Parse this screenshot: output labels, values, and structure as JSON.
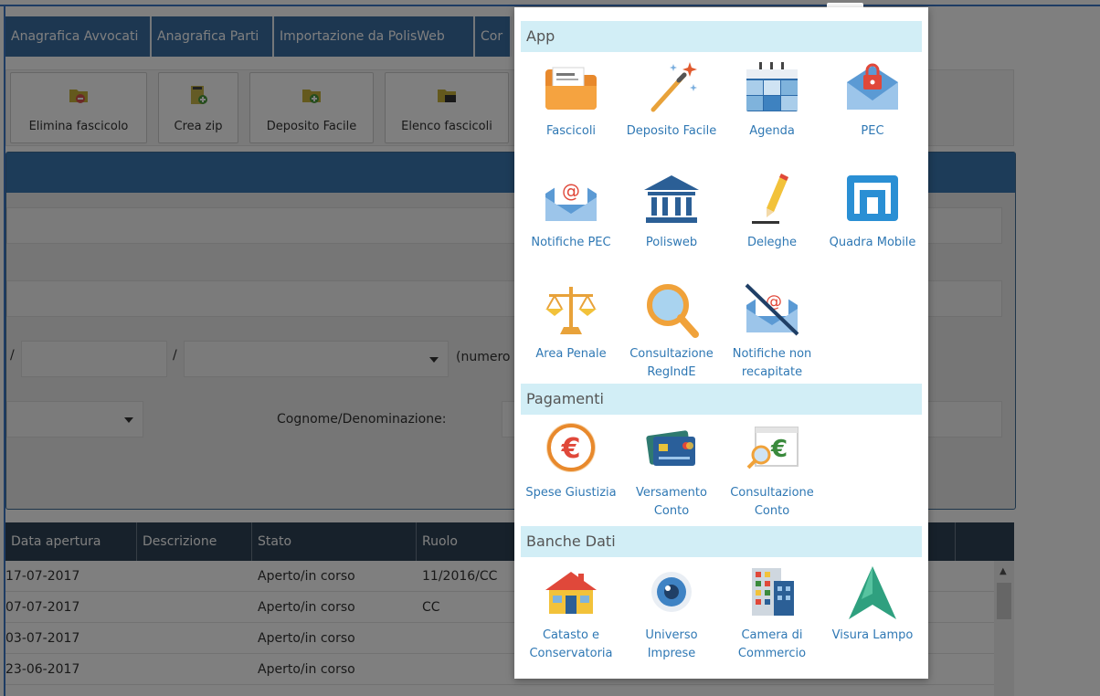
{
  "tabs": [
    "Anagrafica Avvocati",
    "Anagrafica Parti",
    "Importazione da PolisWeb",
    "Cor"
  ],
  "toolbar": {
    "buttons": [
      "Elimina fascicolo",
      "Crea zip",
      "Deposito Facile",
      "Elenco fascicoli"
    ]
  },
  "form": {
    "slash1": "/",
    "slash2": "/",
    "numero_hint": "(numero",
    "cognome_label": "Cognome/Denominazione:"
  },
  "grid": {
    "columns": [
      "Data apertura",
      "Descrizione",
      "Stato",
      "Ruolo"
    ],
    "rows": [
      {
        "data": "17-07-2017",
        "stato": "Aperto/in corso",
        "ruolo": "11/2016/CC"
      },
      {
        "data": "07-07-2017",
        "stato": "Aperto/in corso",
        "ruolo": "CC"
      },
      {
        "data": "03-07-2017",
        "stato": "Aperto/in corso",
        "ruolo": ""
      },
      {
        "data": "23-06-2017",
        "stato": "Aperto/in corso",
        "ruolo": ""
      }
    ]
  },
  "popup": {
    "app_title": "App",
    "pagamenti_title": "Pagamenti",
    "banche_title": "Banche Dati",
    "apps": [
      {
        "label1": "Fascicoli",
        "label2": "",
        "icon": "folder-icon"
      },
      {
        "label1": "Deposito Facile",
        "label2": "",
        "icon": "magic-wand-icon"
      },
      {
        "label1": "Agenda",
        "label2": "",
        "icon": "calendar-icon"
      },
      {
        "label1": "PEC",
        "label2": "",
        "icon": "locked-mail-icon"
      },
      {
        "label1": "Notifiche PEC",
        "label2": "",
        "icon": "at-mail-icon"
      },
      {
        "label1": "Polisweb",
        "label2": "",
        "icon": "courthouse-icon"
      },
      {
        "label1": "Deleghe",
        "label2": "",
        "icon": "pencil-icon"
      },
      {
        "label1": "Quadra Mobile",
        "label2": "",
        "icon": "quadra-icon"
      },
      {
        "label1": "Area Penale",
        "label2": "",
        "icon": "scales-icon"
      },
      {
        "label1": "Consultazione",
        "label2": "RegIndE",
        "icon": "magnifier-icon"
      },
      {
        "label1": "Notifiche non",
        "label2": "recapitate",
        "icon": "crossed-mail-icon"
      }
    ],
    "pagamenti": [
      {
        "label1": "Spese Giustizia",
        "label2": "",
        "icon": "euro-icon"
      },
      {
        "label1": "Versamento",
        "label2": "Conto",
        "icon": "credit-card-icon"
      },
      {
        "label1": "Consultazione",
        "label2": "Conto",
        "icon": "euro-search-icon"
      }
    ],
    "banche": [
      {
        "label1": "Catasto e",
        "label2": "Conservatoria",
        "icon": "house-icon"
      },
      {
        "label1": "Universo",
        "label2": "Imprese",
        "icon": "eye-icon"
      },
      {
        "label1": "Camera di",
        "label2": "Commercio",
        "icon": "building-icon"
      },
      {
        "label1": "Visura Lampo",
        "label2": "",
        "icon": "visura-logo-icon"
      }
    ]
  }
}
